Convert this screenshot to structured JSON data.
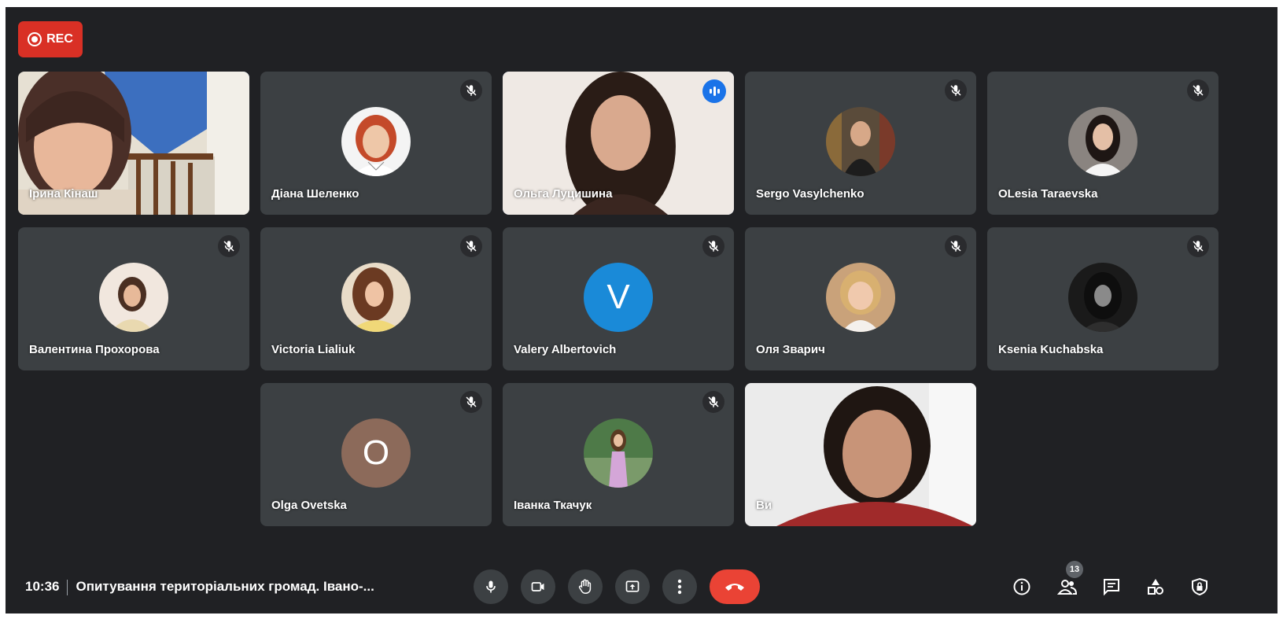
{
  "recording": {
    "label": "REC"
  },
  "participants": [
    {
      "name": "Ірина Кінаш"
    },
    {
      "name": "Діана Шеленко"
    },
    {
      "name": "Ольга Луцишина"
    },
    {
      "name": "Sergo Vasylchenko"
    },
    {
      "name": "OLesia Taraevska"
    },
    {
      "name": "Валентина Прохорова"
    },
    {
      "name": "Victoria Lialiuk"
    },
    {
      "name": "Valery Albertovich",
      "initial": "V",
      "color": "#1a8ad8"
    },
    {
      "name": "Оля Зварич"
    },
    {
      "name": "Ksenia Kuchabska"
    },
    {
      "name": "Olga Ovetska",
      "initial": "O",
      "color": "#8c6a5a"
    },
    {
      "name": "Іванка Ткачук"
    },
    {
      "name": "Ви"
    }
  ],
  "meeting": {
    "time": "10:36",
    "title": "Опитування територіальних громад. Івано-..."
  },
  "controls": [
    "mic-icon",
    "camera-icon",
    "raise-hand-icon",
    "present-icon",
    "more-options-icon",
    "hang-up-icon"
  ],
  "side_controls": {
    "people_count": "13",
    "icons": [
      "info-icon",
      "people-icon",
      "chat-icon",
      "activities-icon",
      "host-controls-icon"
    ]
  },
  "colors": {
    "background": "#202124",
    "tile": "#3c4043",
    "rec": "#d93025",
    "hangup": "#ea4335",
    "speaking_border": "#8ab4f8"
  }
}
